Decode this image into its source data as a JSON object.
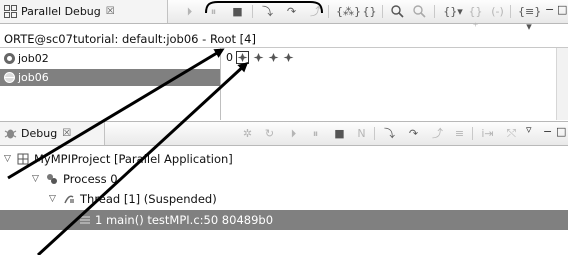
{
  "parallel_debug": {
    "tab_title": "Parallel Debug",
    "tab_close": "☒",
    "info": "ORTE@sc07tutorial: default:job06 - Root [4]",
    "jobs": [
      {
        "label": "job02",
        "selected": false
      },
      {
        "label": "job06",
        "selected": true
      }
    ],
    "process_set_index": "0",
    "toolbar_glyphs": {
      "resume": "⏵",
      "suspend": "⏸",
      "terminate": "■",
      "step_into": "⤵",
      "step_over": "↷",
      "step_return": "⤴",
      "register_group": "{⁂}",
      "unregister_group": "{}",
      "zoom_in": "+",
      "zoom_out": "−",
      "view_menu": "▾",
      "minimize": "−",
      "maximize": "□"
    }
  },
  "debug": {
    "tab_title": "Debug",
    "tab_close": "☒",
    "tree": [
      {
        "label": "MyMPIProject [Parallel Application]",
        "level": 0,
        "expanded": true,
        "icon": "launch-icon"
      },
      {
        "label": "Process 0",
        "level": 1,
        "expanded": true,
        "icon": "process-icon"
      },
      {
        "label": "Thread [1] (Suspended)",
        "level": 2,
        "expanded": true,
        "icon": "thread-icon"
      },
      {
        "label": "1 main() testMPI.c:50 80489b0",
        "level": 3,
        "selected": true,
        "icon": "stack-frame-icon"
      }
    ]
  },
  "colors": {
    "selection": "#808080",
    "annotation_arrow": "#000000"
  }
}
